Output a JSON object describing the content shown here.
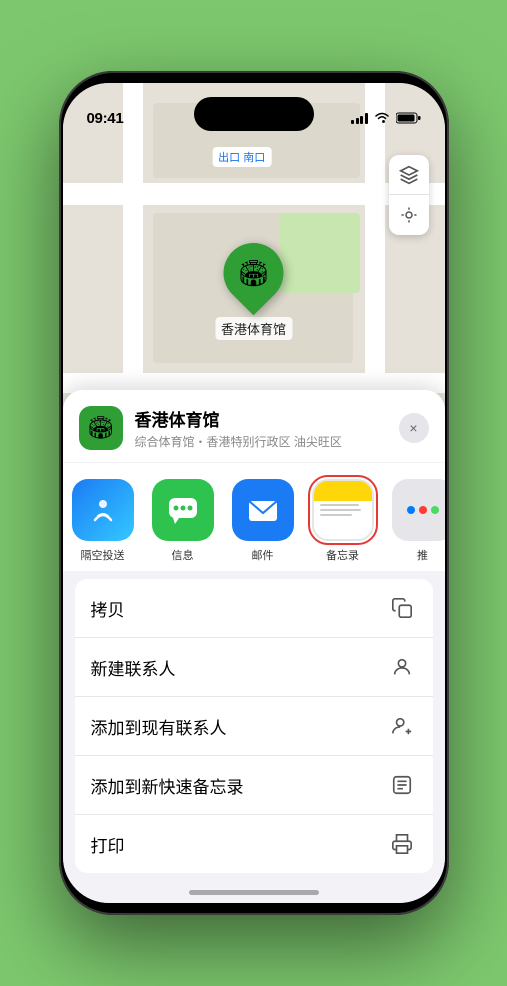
{
  "status_bar": {
    "time": "09:41",
    "location_icon": "▶"
  },
  "map": {
    "label": "南口",
    "label_prefix": "出口"
  },
  "pin": {
    "label": "香港体育馆",
    "emoji": "🏟"
  },
  "sheet": {
    "venue_name": "香港体育馆",
    "venue_sub": "综合体育馆・香港特别行政区 油尖旺区",
    "close_label": "×"
  },
  "share_apps": [
    {
      "id": "airdrop",
      "label": "隔空投送",
      "selected": false
    },
    {
      "id": "messages",
      "label": "信息",
      "selected": false
    },
    {
      "id": "mail",
      "label": "邮件",
      "selected": false
    },
    {
      "id": "notes",
      "label": "备忘录",
      "selected": true
    },
    {
      "id": "more",
      "label": "推",
      "selected": false
    }
  ],
  "actions": [
    {
      "id": "copy",
      "label": "拷贝",
      "icon": "⎘"
    },
    {
      "id": "new-contact",
      "label": "新建联系人",
      "icon": "👤"
    },
    {
      "id": "add-existing",
      "label": "添加到现有联系人",
      "icon": "👤+"
    },
    {
      "id": "add-quick-note",
      "label": "添加到新快速备忘录",
      "icon": "📝"
    },
    {
      "id": "print",
      "label": "打印",
      "icon": "🖨"
    }
  ]
}
